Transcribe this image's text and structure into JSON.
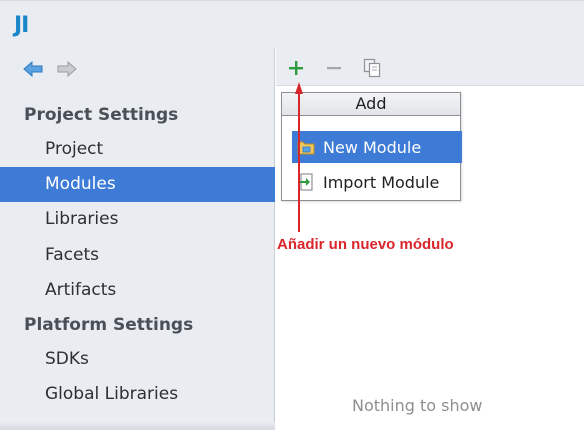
{
  "window": {
    "logo": "JI",
    "logo_color": "#1d86c8"
  },
  "sidebar": {
    "nav": {
      "back_icon": "back-arrow-icon",
      "forward_icon": "forward-arrow-icon"
    },
    "sections": [
      {
        "header": "Project Settings",
        "items": [
          {
            "label": "Project",
            "selected": false
          },
          {
            "label": "Modules",
            "selected": true
          },
          {
            "label": "Libraries",
            "selected": false
          },
          {
            "label": "Facets",
            "selected": false
          },
          {
            "label": "Artifacts",
            "selected": false
          }
        ]
      },
      {
        "header": "Platform Settings",
        "items": [
          {
            "label": "SDKs",
            "selected": false
          },
          {
            "label": "Global Libraries",
            "selected": false
          }
        ]
      }
    ]
  },
  "toolbar": {
    "add_icon": "plus-icon",
    "remove_icon": "minus-icon",
    "copy_icon": "copy-icon"
  },
  "add_popup": {
    "title": "Add",
    "items": [
      {
        "label": "New Module",
        "icon": "module-folder-icon",
        "selected": true
      },
      {
        "label": "Import Module",
        "icon": "import-module-icon",
        "selected": false
      }
    ]
  },
  "annotation": {
    "text": "Añadir un nuevo módulo",
    "color": "#d8262c"
  },
  "main": {
    "empty_text": "Nothing to show"
  },
  "colors": {
    "selection": "#3d7bd6",
    "panel_bg": "#e9ecf1",
    "add_green": "#2e9b3e"
  }
}
